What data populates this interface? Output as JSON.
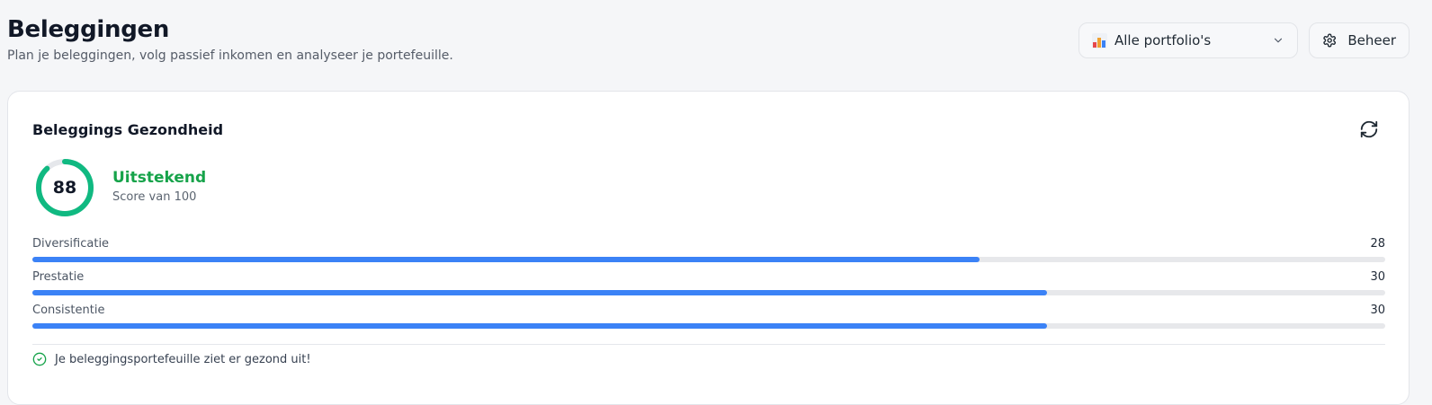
{
  "header": {
    "title": "Beleggingen",
    "subtitle": "Plan je beleggingen, volg passief inkomen en analyseer je portefeuille."
  },
  "toolbar": {
    "portfolio_select": {
      "icon": "bar-chart-emoji-icon",
      "value": "Alle portfolio's"
    },
    "manage_label": "Beheer",
    "manage_icon": "gear-icon"
  },
  "health_card": {
    "title": "Beleggings Gezondheid",
    "refresh_icon": "refresh-icon",
    "score": {
      "value": "88",
      "max": 100,
      "rating": "Uitstekend",
      "caption": "Score van 100"
    },
    "metrics": [
      {
        "label": "Diversificatie",
        "value": "28",
        "fill_fraction": 0.7
      },
      {
        "label": "Prestatie",
        "value": "30",
        "fill_fraction": 0.75
      },
      {
        "label": "Consistentie",
        "value": "30",
        "fill_fraction": 0.75
      }
    ],
    "status": {
      "icon": "check-circle-icon",
      "text": "Je beleggingsportefeuille ziet er gezond uit!"
    }
  },
  "colors": {
    "accent_green": "#16a34a",
    "ring_green": "#10b981",
    "bar_blue": "#3b82f6",
    "track_gray": "#e7e8eb"
  }
}
